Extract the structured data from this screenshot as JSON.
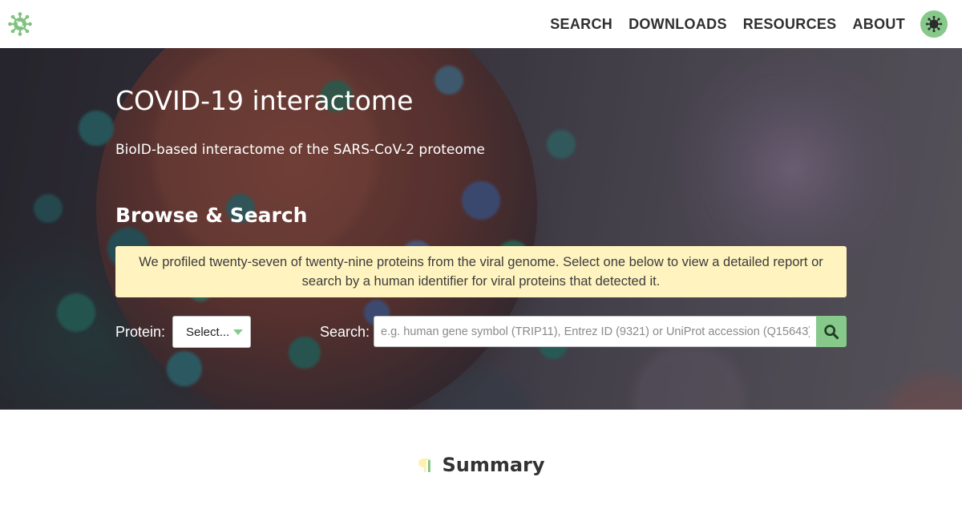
{
  "nav": {
    "logo_icon": "virus-logo-icon",
    "links": [
      "SEARCH",
      "DOWNLOADS",
      "RESOURCES",
      "ABOUT"
    ],
    "theme_toggle_icon": "virus-icon"
  },
  "hero": {
    "title": "COVID-19 interactome",
    "subtitle": "BioID-based interactome of the SARS-CoV-2 proteome",
    "section_heading": "Browse & Search",
    "notice": "We profiled twenty-seven of twenty-nine proteins from the viral genome. Select one below to view a detailed report or search by a human identifier for viral proteins that detected it.",
    "protein_label": "Protein:",
    "protein_select_value": "Select...",
    "search_label": "Search:",
    "search_placeholder": "e.g. human gene symbol (TRIP11), Entrez ID (9321) or UniProt accession (Q15643)",
    "search_value": "",
    "search_icon": "magnifier-icon"
  },
  "summary": {
    "icon": "paragraph-icon",
    "title": "Summary"
  },
  "colors": {
    "accent": "#86c98b",
    "notice_bg": "#fff3bf",
    "nav_text": "#2f2f2f",
    "hero_text": "#ffffff"
  }
}
